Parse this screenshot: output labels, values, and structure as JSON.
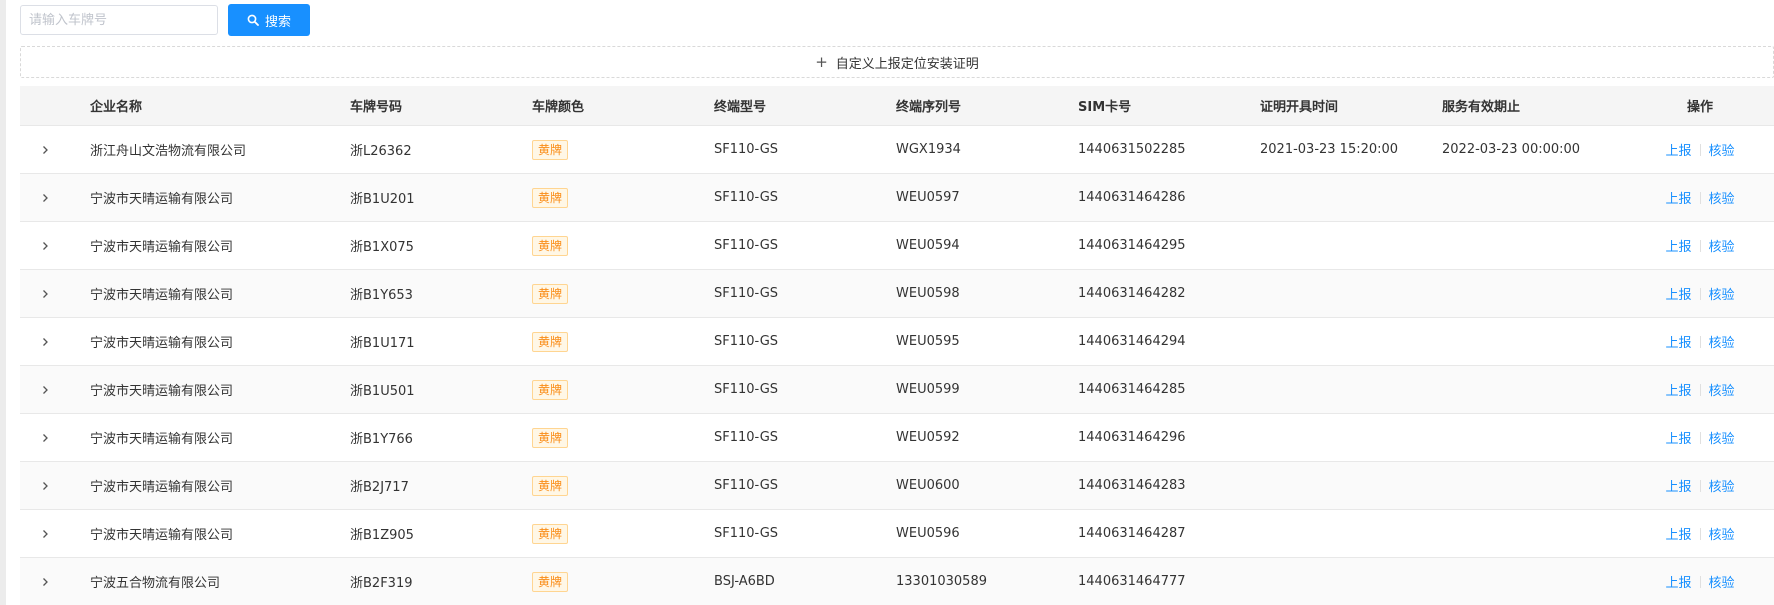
{
  "search": {
    "placeholder": "请输入车牌号",
    "button_label": "搜索"
  },
  "custom_report": {
    "label": "自定义上报定位安装证明"
  },
  "table": {
    "headers": [
      "企业名称",
      "车牌号码",
      "车牌颜色",
      "终端型号",
      "终端序列号",
      "SIM卡号",
      "证明开具时间",
      "服务有效期止",
      "操作"
    ],
    "actions": {
      "report": "上报",
      "verify": "核验"
    },
    "rows": [
      {
        "enterprise": "浙江舟山文浩物流有限公司",
        "plate": "浙L26362",
        "color": "黄牌",
        "terminal_model": "SF110-GS",
        "serial": "WGX1934",
        "sim": "1440631502285",
        "issued": "2021-03-23 15:20:00",
        "valid_until": "2022-03-23 00:00:00"
      },
      {
        "enterprise": "宁波市天晴运输有限公司",
        "plate": "浙B1U201",
        "color": "黄牌",
        "terminal_model": "SF110-GS",
        "serial": "WEU0597",
        "sim": "1440631464286",
        "issued": "",
        "valid_until": ""
      },
      {
        "enterprise": "宁波市天晴运输有限公司",
        "plate": "浙B1X075",
        "color": "黄牌",
        "terminal_model": "SF110-GS",
        "serial": "WEU0594",
        "sim": "1440631464295",
        "issued": "",
        "valid_until": ""
      },
      {
        "enterprise": "宁波市天晴运输有限公司",
        "plate": "浙B1Y653",
        "color": "黄牌",
        "terminal_model": "SF110-GS",
        "serial": "WEU0598",
        "sim": "1440631464282",
        "issued": "",
        "valid_until": ""
      },
      {
        "enterprise": "宁波市天晴运输有限公司",
        "plate": "浙B1U171",
        "color": "黄牌",
        "terminal_model": "SF110-GS",
        "serial": "WEU0595",
        "sim": "1440631464294",
        "issued": "",
        "valid_until": ""
      },
      {
        "enterprise": "宁波市天晴运输有限公司",
        "plate": "浙B1U501",
        "color": "黄牌",
        "terminal_model": "SF110-GS",
        "serial": "WEU0599",
        "sim": "1440631464285",
        "issued": "",
        "valid_until": ""
      },
      {
        "enterprise": "宁波市天晴运输有限公司",
        "plate": "浙B1Y766",
        "color": "黄牌",
        "terminal_model": "SF110-GS",
        "serial": "WEU0592",
        "sim": "1440631464296",
        "issued": "",
        "valid_until": ""
      },
      {
        "enterprise": "宁波市天晴运输有限公司",
        "plate": "浙B2J717",
        "color": "黄牌",
        "terminal_model": "SF110-GS",
        "serial": "WEU0600",
        "sim": "1440631464283",
        "issued": "",
        "valid_until": ""
      },
      {
        "enterprise": "宁波市天晴运输有限公司",
        "plate": "浙B1Z905",
        "color": "黄牌",
        "terminal_model": "SF110-GS",
        "serial": "WEU0596",
        "sim": "1440631464287",
        "issued": "",
        "valid_until": ""
      },
      {
        "enterprise": "宁波五合物流有限公司",
        "plate": "浙B2F319",
        "color": "黄牌",
        "terminal_model": "BSJ-A6BD",
        "serial": "13301030589",
        "sim": "1440631464777",
        "issued": "",
        "valid_until": ""
      }
    ]
  },
  "colors": {
    "primary": "#1890ff",
    "tag_text": "#fa8c16",
    "tag_border": "#ffd591",
    "tag_bg": "#fff7e6",
    "header_bg": "#f5f5f5"
  },
  "icons": {
    "search": "search-icon",
    "plus": "plus-icon",
    "expand": "chevron-right-icon"
  }
}
